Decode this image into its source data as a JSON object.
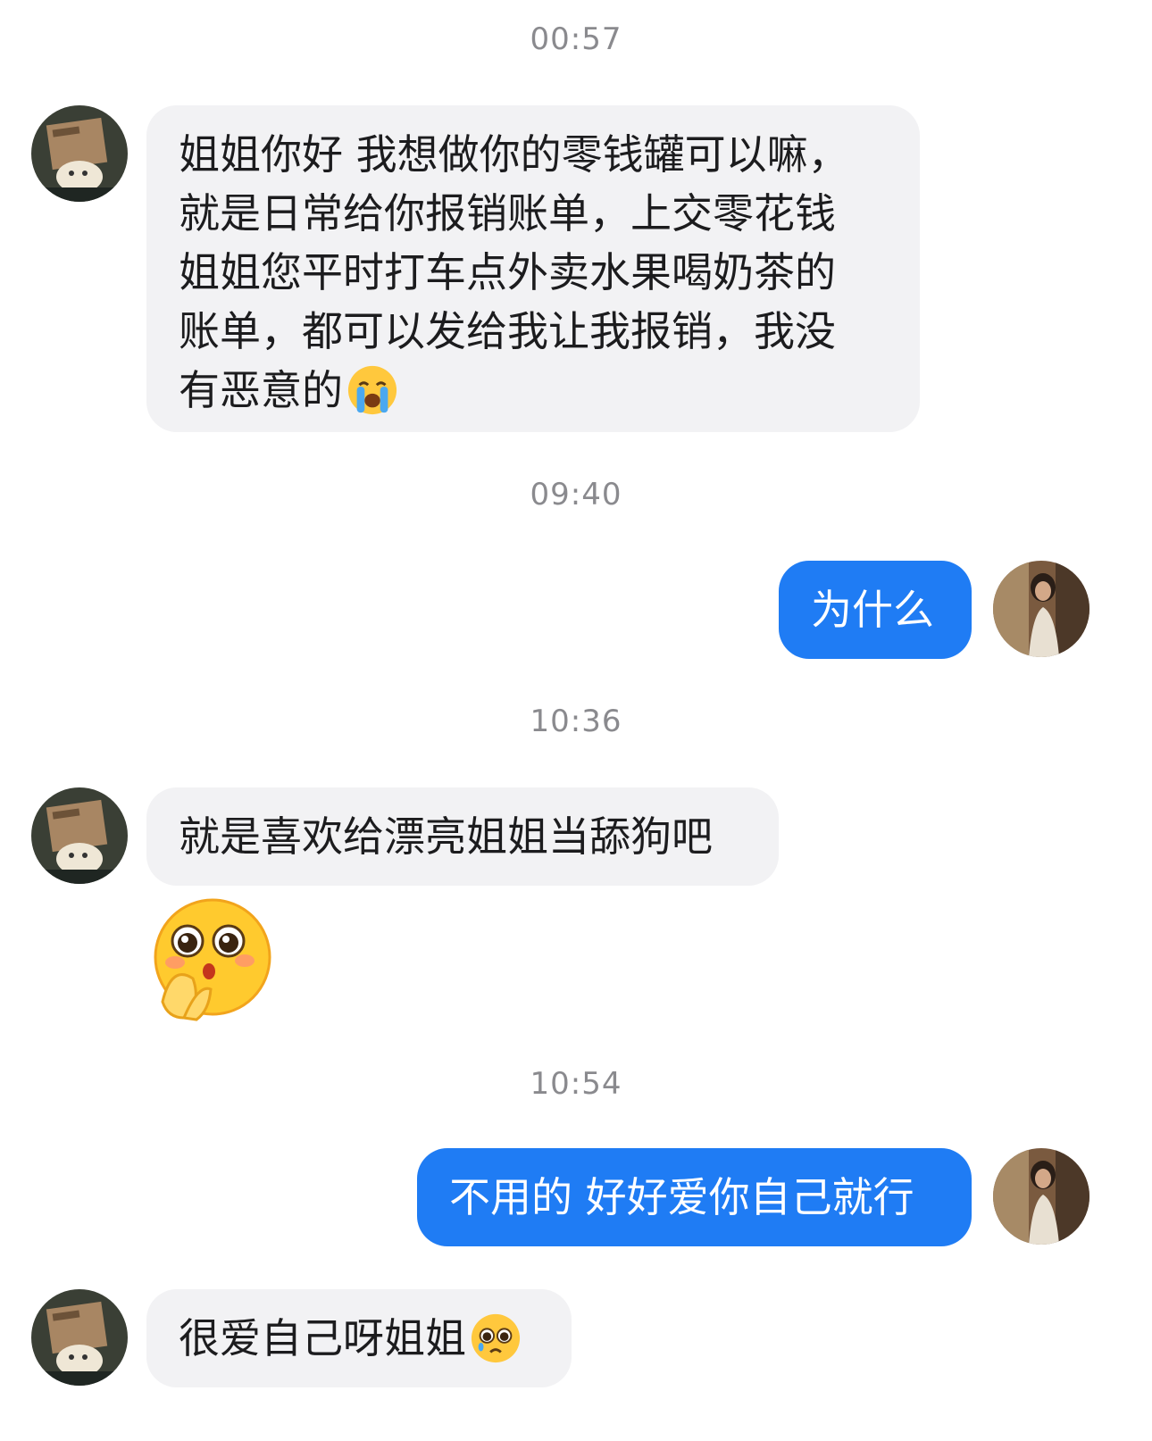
{
  "chat": {
    "timestamps": [
      "00:57",
      "09:40",
      "10:36",
      "10:54"
    ],
    "messages": [
      {
        "sender": "other",
        "lines": [
          "姐姐你好 我想做你的零钱罐可以嘛，",
          "就是日常给你报销账单，上交零花钱",
          "姐姐您平时打车点外卖水果喝奶茶的",
          "账单，都可以发给我让我报销，我没",
          "有恶意的"
        ],
        "trailing_emoji": "loudly-crying-face"
      },
      {
        "sender": "me",
        "text": "为什么"
      },
      {
        "sender": "other",
        "text": "就是喜欢给漂亮姐姐当舔狗吧"
      },
      {
        "sender": "other",
        "sticker": "pleading-hands-sticker"
      },
      {
        "sender": "me",
        "text": "不用的 好好爱你自己就行"
      },
      {
        "sender": "other",
        "text": "很爱自己呀姐姐",
        "trailing_emoji": "pleading-tearful-face"
      }
    ]
  },
  "avatars": {
    "other": "box-head-plush-avatar",
    "me": "woman-portrait-avatar"
  },
  "colors": {
    "incoming_bubble": "#f2f2f4",
    "outgoing_bubble": "#1f7cf4",
    "timestamp": "#8a8a8e",
    "text": "#1c1c1e"
  }
}
